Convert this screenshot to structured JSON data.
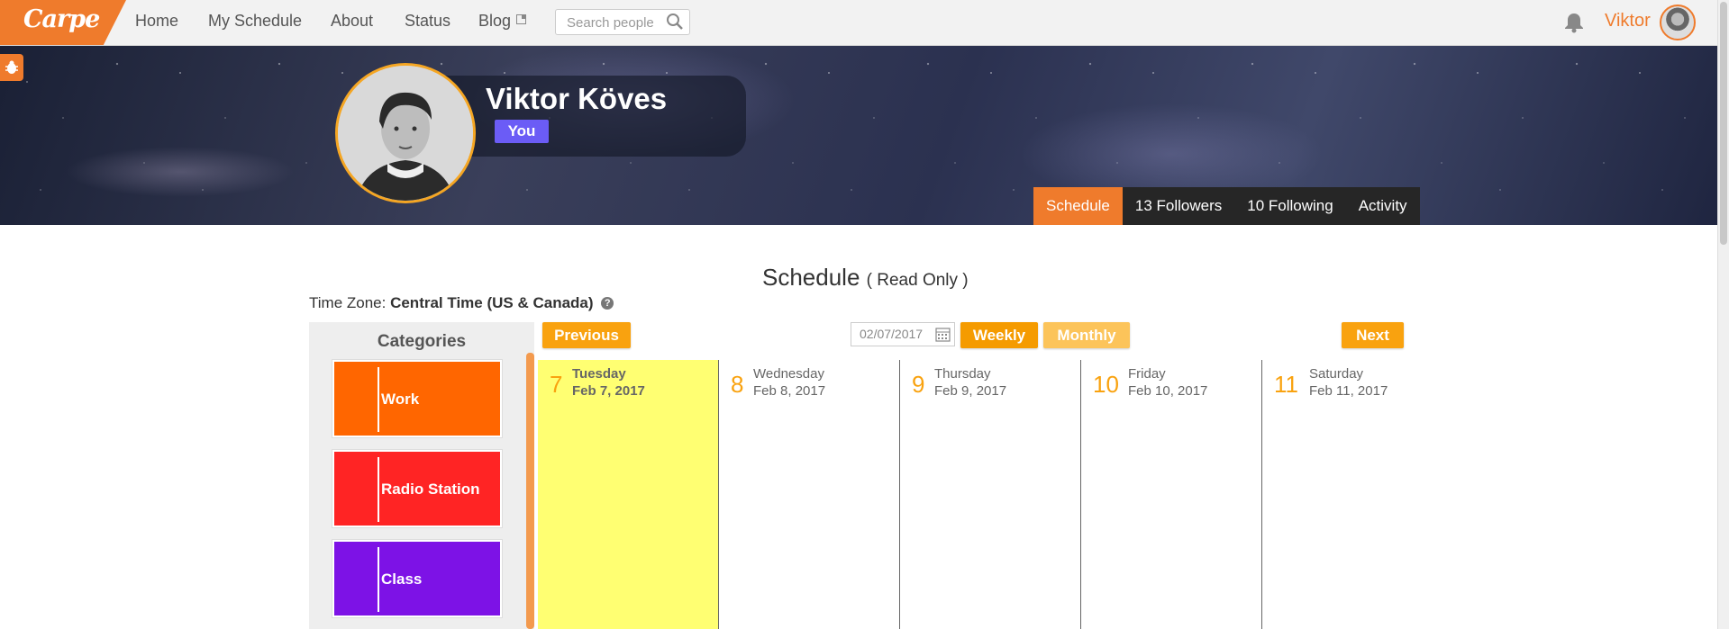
{
  "nav": {
    "logo": "Carpe",
    "links": [
      "Home",
      "My Schedule",
      "About",
      "Status",
      "Blog"
    ],
    "search_placeholder": "Search people",
    "username": "Viktor"
  },
  "profile": {
    "name": "Viktor Köves",
    "badge": "You",
    "tabs": [
      "Schedule",
      "13 Followers",
      "10 Following",
      "Activity"
    ]
  },
  "schedule": {
    "title": "Schedule",
    "mode": "( Read Only )",
    "timezone_label": "Time Zone:",
    "timezone": "Central Time (US & Canada)",
    "help": "?",
    "prev": "Previous",
    "next": "Next",
    "date": "02/07/2017",
    "view_weekly": "Weekly",
    "view_monthly": "Monthly",
    "categories_title": "Categories",
    "categories": [
      {
        "label": "Work",
        "color": "#ff6600"
      },
      {
        "label": "Radio Station",
        "color": "#ff2424"
      },
      {
        "label": "Class",
        "color": "#7d12e6"
      }
    ],
    "days": [
      {
        "num": "7",
        "weekday": "Tuesday",
        "date": "Feb 7, 2017",
        "today": true
      },
      {
        "num": "8",
        "weekday": "Wednesday",
        "date": "Feb 8, 2017"
      },
      {
        "num": "9",
        "weekday": "Thursday",
        "date": "Feb 9, 2017"
      },
      {
        "num": "10",
        "weekday": "Friday",
        "date": "Feb 10, 2017"
      },
      {
        "num": "11",
        "weekday": "Saturday",
        "date": "Feb 11, 2017"
      }
    ]
  },
  "colors": {
    "accent": "#ef7b2c",
    "button": "#f9a20f",
    "badge": "#6b5cf6",
    "today": "#ffff72"
  }
}
